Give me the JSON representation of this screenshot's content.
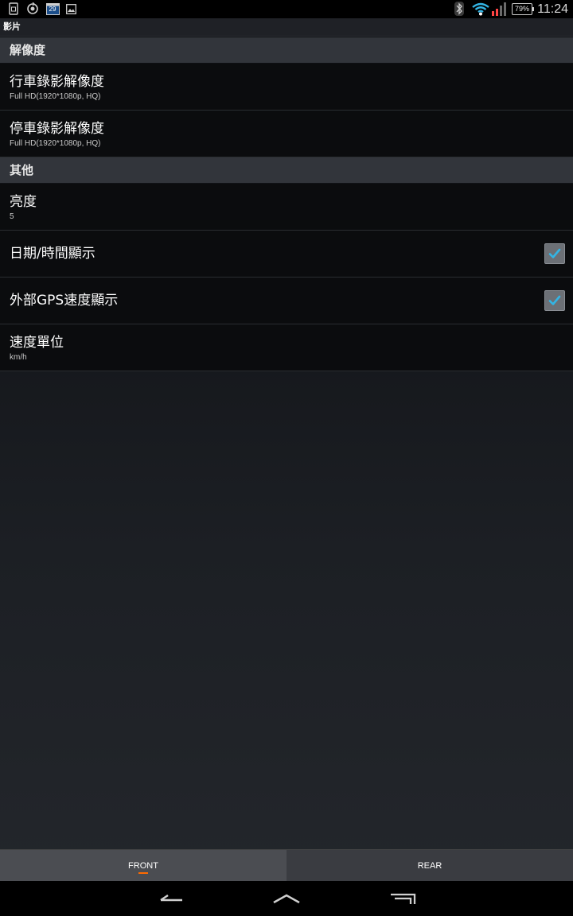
{
  "status_bar": {
    "calendar_date": "29",
    "battery_percent": "79%",
    "time": "11:24"
  },
  "title_bar": {
    "title": "影片"
  },
  "sections": [
    {
      "header": "解像度",
      "rows": [
        {
          "title": "行車錄影解像度",
          "summary": "Full HD(1920*1080p, HQ)"
        },
        {
          "title": "停車錄影解像度",
          "summary": "Full HD(1920*1080p, HQ)"
        }
      ]
    },
    {
      "header": "其他",
      "rows": [
        {
          "title": "亮度",
          "summary": "5"
        },
        {
          "title": "日期/時間顯示",
          "checked": true
        },
        {
          "title": "外部GPS速度顯示",
          "checked": true
        },
        {
          "title": "速度單位",
          "summary": "km/h"
        }
      ]
    }
  ],
  "tabs": {
    "front": "FRONT",
    "rear": "REAR",
    "selected": "FRONT"
  },
  "colors": {
    "accent": "#ff6a00",
    "check": "#33b5e5"
  },
  "icons": {
    "status_left": [
      "sim-card-icon",
      "sync-icon",
      "calendar-icon",
      "image-icon"
    ],
    "status_right": [
      "bluetooth-icon",
      "wifi-icon",
      "signal-icon",
      "battery-icon"
    ],
    "nav": [
      "back-icon",
      "home-icon",
      "recent-apps-icon"
    ]
  }
}
